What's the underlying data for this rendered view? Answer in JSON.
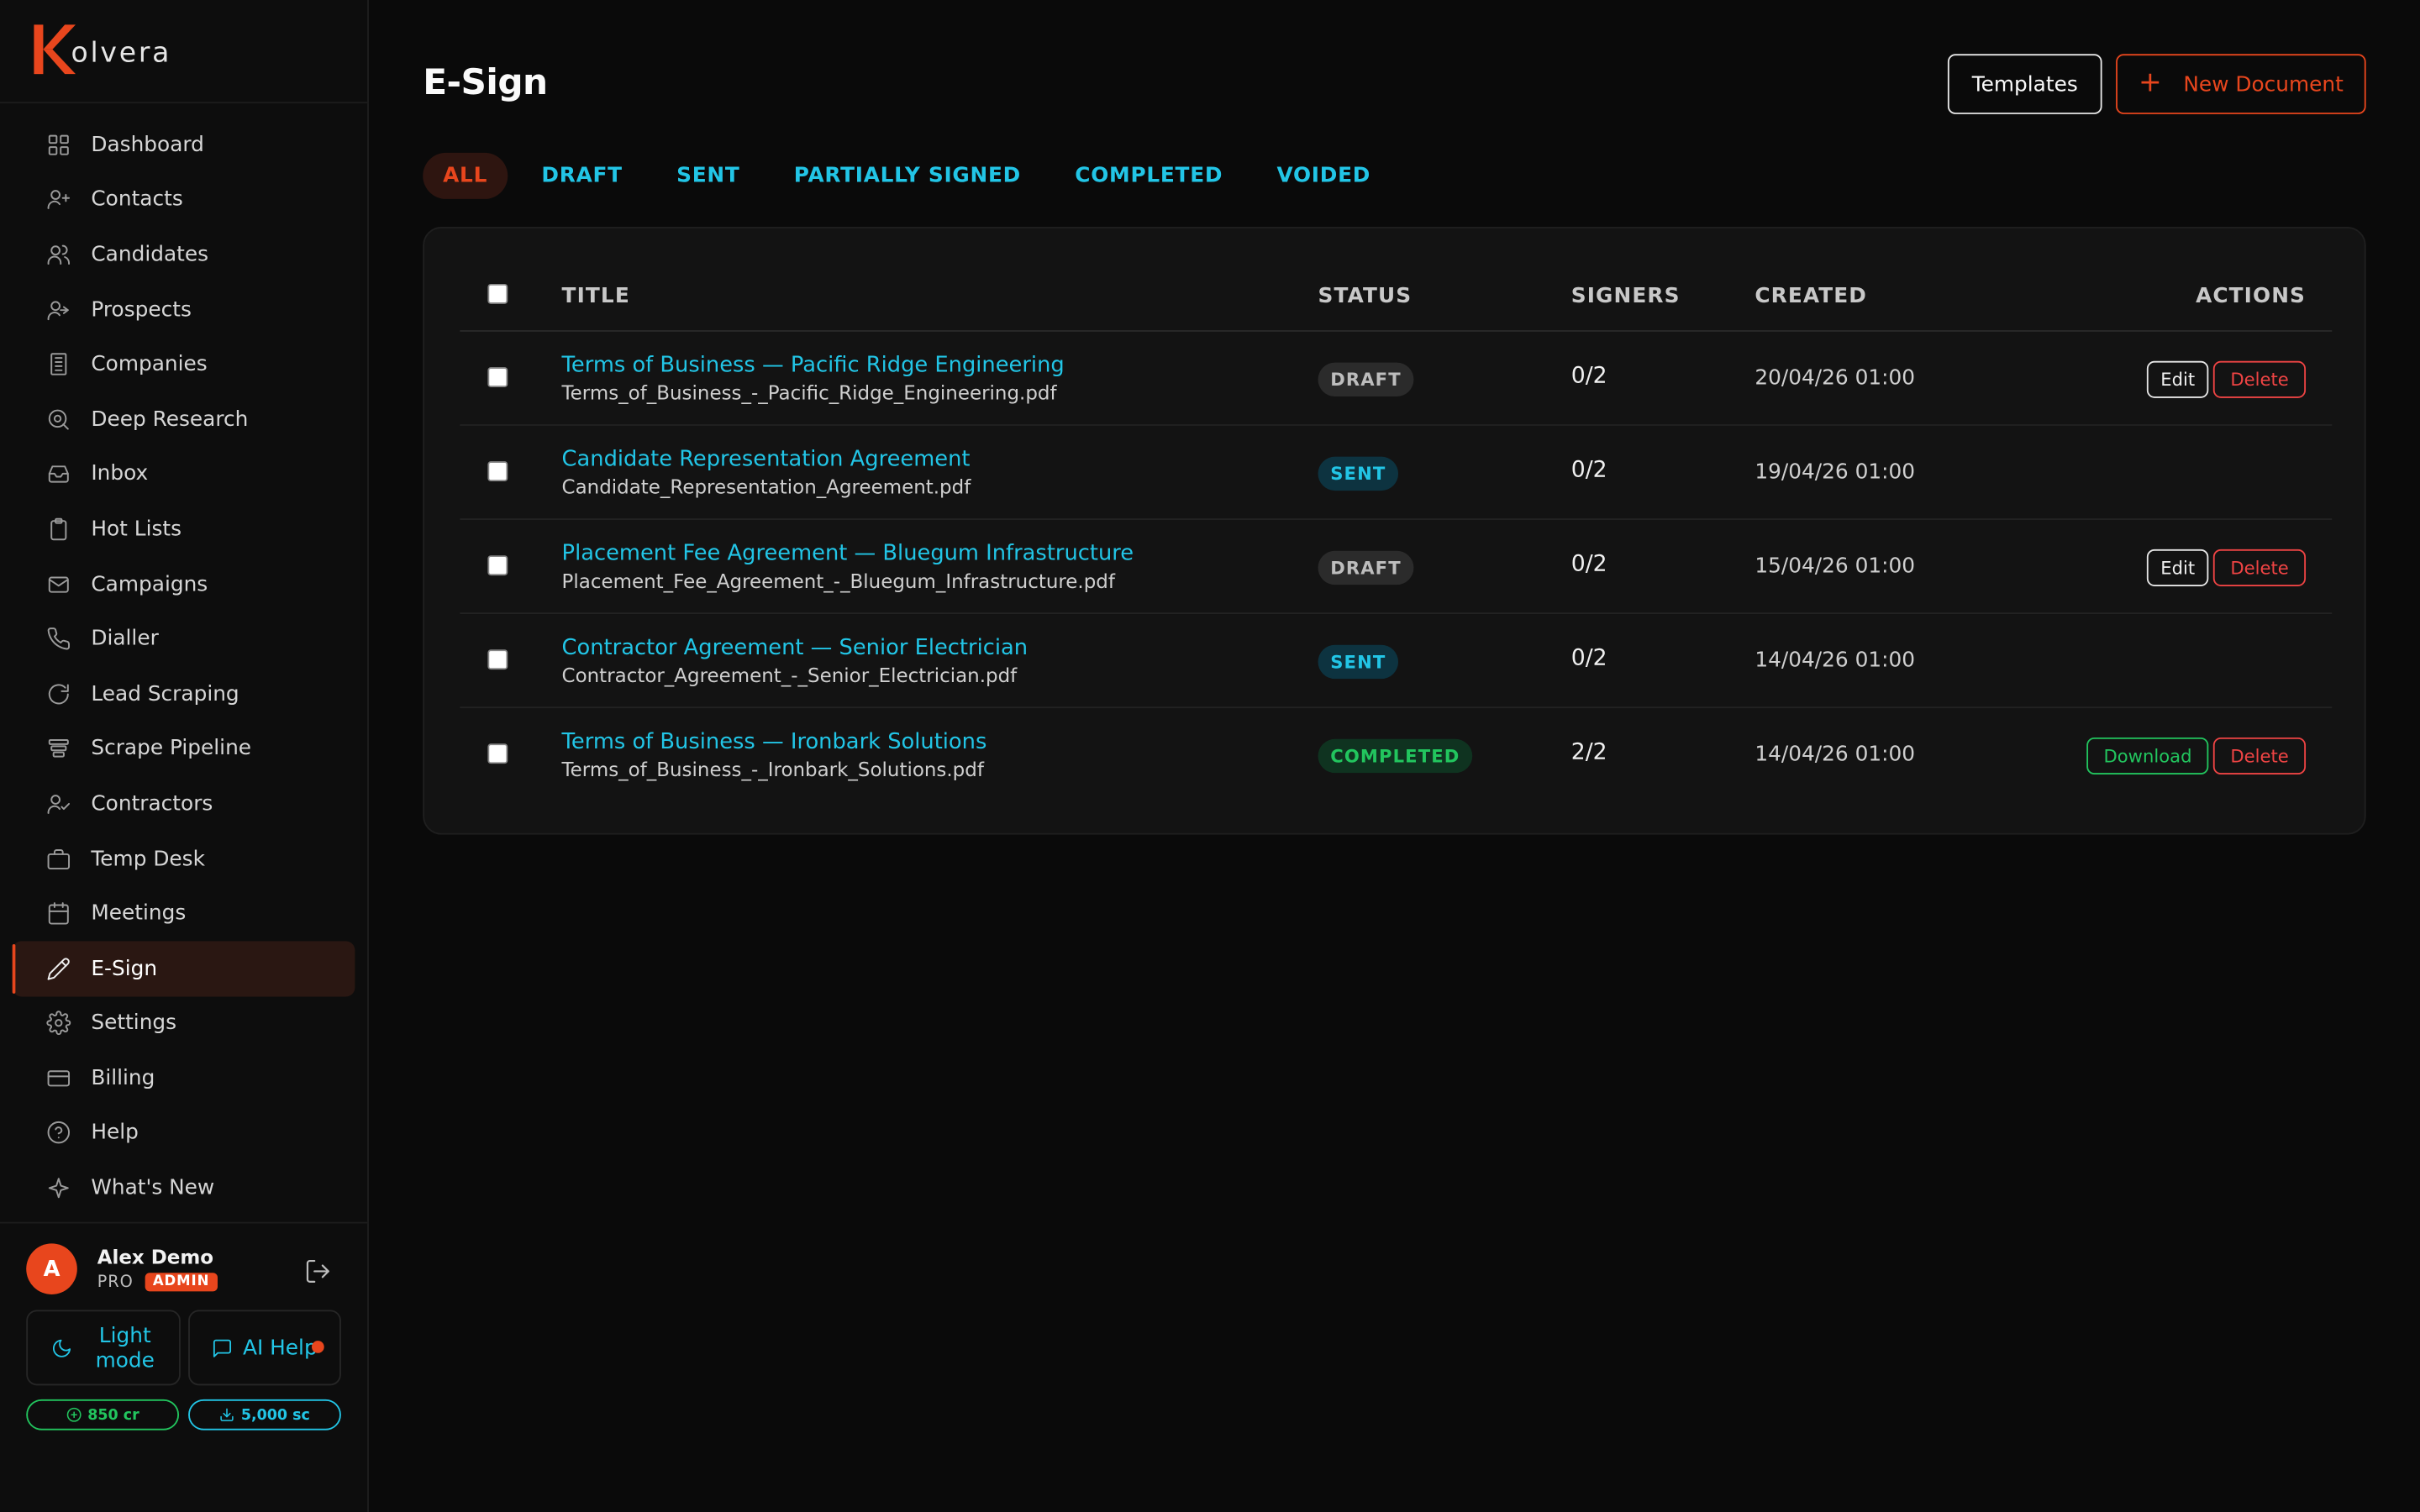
{
  "brand": {
    "name": "olvera",
    "accent": "#e8461d",
    "link": "#22c5e6",
    "success": "#22c55e"
  },
  "sidebar": {
    "items": [
      {
        "label": "Dashboard",
        "icon": "grid-icon"
      },
      {
        "label": "Contacts",
        "icon": "user-plus-icon"
      },
      {
        "label": "Candidates",
        "icon": "users-icon"
      },
      {
        "label": "Prospects",
        "icon": "user-arrow-icon"
      },
      {
        "label": "Companies",
        "icon": "building-icon"
      },
      {
        "label": "Deep Research",
        "icon": "search-icon"
      },
      {
        "label": "Inbox",
        "icon": "inbox-icon"
      },
      {
        "label": "Hot Lists",
        "icon": "clipboard-icon"
      },
      {
        "label": "Campaigns",
        "icon": "mail-icon"
      },
      {
        "label": "Dialler",
        "icon": "phone-icon"
      },
      {
        "label": "Lead Scraping",
        "icon": "refresh-icon"
      },
      {
        "label": "Scrape Pipeline",
        "icon": "layers-icon"
      },
      {
        "label": "Contractors",
        "icon": "user-check-icon"
      },
      {
        "label": "Temp Desk",
        "icon": "briefcase-icon"
      },
      {
        "label": "Meetings",
        "icon": "calendar-icon"
      },
      {
        "label": "E-Sign",
        "icon": "pen-icon",
        "active": true
      },
      {
        "label": "Settings",
        "icon": "gear-icon"
      },
      {
        "label": "Billing",
        "icon": "card-icon"
      },
      {
        "label": "Help",
        "icon": "help-icon"
      },
      {
        "label": "What's New",
        "icon": "sparkle-icon"
      }
    ],
    "user": {
      "initial": "A",
      "name": "Alex Demo",
      "plan": "PRO",
      "role": "ADMIN"
    },
    "theme_toggle": "Light mode",
    "ai_help": "AI Help",
    "credits": "850 cr",
    "scrape_credits": "5,000 sc"
  },
  "header": {
    "title": "E-Sign",
    "templates_label": "Templates",
    "new_document_label": "New Document"
  },
  "tabs": [
    {
      "label": "ALL",
      "active": true
    },
    {
      "label": "DRAFT"
    },
    {
      "label": "SENT"
    },
    {
      "label": "PARTIALLY SIGNED"
    },
    {
      "label": "COMPLETED"
    },
    {
      "label": "VOIDED"
    }
  ],
  "table": {
    "columns": {
      "title": "TITLE",
      "status": "STATUS",
      "signers": "SIGNERS",
      "created": "CREATED",
      "actions": "ACTIONS"
    },
    "rows": [
      {
        "title": "Terms of Business — Pacific Ridge Engineering",
        "file": "Terms_of_Business_-_Pacific_Ridge_Engineering.pdf",
        "status": "DRAFT",
        "signers": "0/2",
        "created": "20/04/26 01:00",
        "actions": [
          "Edit",
          "Delete"
        ]
      },
      {
        "title": "Candidate Representation Agreement",
        "file": "Candidate_Representation_Agreement.pdf",
        "status": "SENT",
        "signers": "0/2",
        "created": "19/04/26 01:00",
        "actions": []
      },
      {
        "title": "Placement Fee Agreement — Bluegum Infrastructure",
        "file": "Placement_Fee_Agreement_-_Bluegum_Infrastructure.pdf",
        "status": "DRAFT",
        "signers": "0/2",
        "created": "15/04/26 01:00",
        "actions": [
          "Edit",
          "Delete"
        ]
      },
      {
        "title": "Contractor Agreement — Senior Electrician",
        "file": "Contractor_Agreement_-_Senior_Electrician.pdf",
        "status": "SENT",
        "signers": "0/2",
        "created": "14/04/26 01:00",
        "actions": []
      },
      {
        "title": "Terms of Business — Ironbark Solutions",
        "file": "Terms_of_Business_-_Ironbark_Solutions.pdf",
        "status": "COMPLETED",
        "signers": "2/2",
        "created": "14/04/26 01:00",
        "actions": [
          "Download",
          "Delete"
        ]
      }
    ]
  }
}
